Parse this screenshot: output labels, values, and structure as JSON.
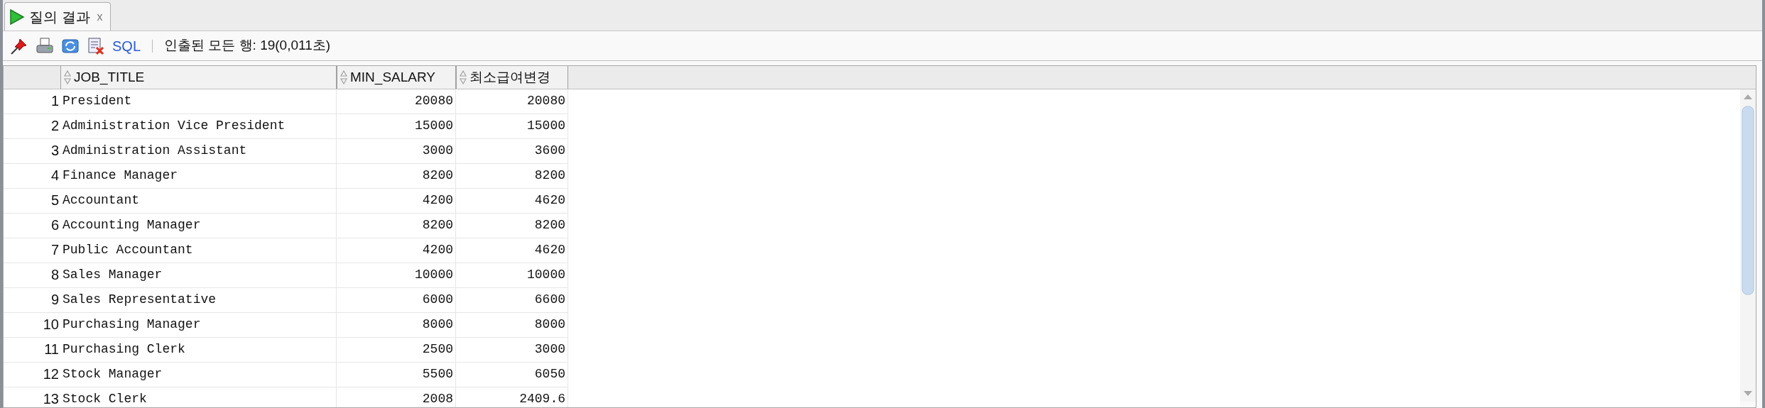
{
  "tab": {
    "title": "질의 결과",
    "close": "x",
    "selected": true
  },
  "toolbar": {
    "sql_label": "SQL",
    "status": "인출된 모든 행: 19(0,011초)"
  },
  "table": {
    "columns": [
      "JOB_TITLE",
      "MIN_SALARY",
      "최소급여변경"
    ],
    "rows": [
      {
        "number": "1",
        "cells": [
          "President",
          "20080",
          "20080"
        ]
      },
      {
        "number": "2",
        "cells": [
          "Administration Vice President",
          "15000",
          "15000"
        ]
      },
      {
        "number": "3",
        "cells": [
          "Administration Assistant",
          "3000",
          "3600"
        ]
      },
      {
        "number": "4",
        "cells": [
          "Finance Manager",
          "8200",
          "8200"
        ]
      },
      {
        "number": "5",
        "cells": [
          "Accountant",
          "4200",
          "4620"
        ]
      },
      {
        "number": "6",
        "cells": [
          "Accounting Manager",
          "8200",
          "8200"
        ]
      },
      {
        "number": "7",
        "cells": [
          "Public Accountant",
          "4200",
          "4620"
        ]
      },
      {
        "number": "8",
        "cells": [
          "Sales Manager",
          "10000",
          "10000"
        ]
      },
      {
        "number": "9",
        "cells": [
          "Sales Representative",
          "6000",
          "6600"
        ]
      },
      {
        "number": "10",
        "cells": [
          "Purchasing Manager",
          "8000",
          "8000"
        ]
      },
      {
        "number": "11",
        "cells": [
          "Purchasing Clerk",
          "2500",
          "3000"
        ]
      },
      {
        "number": "12",
        "cells": [
          "Stock Manager",
          "5500",
          "6050"
        ]
      },
      {
        "number": "13",
        "cells": [
          "Stock Clerk",
          "2008",
          "2409.6"
        ]
      }
    ]
  }
}
